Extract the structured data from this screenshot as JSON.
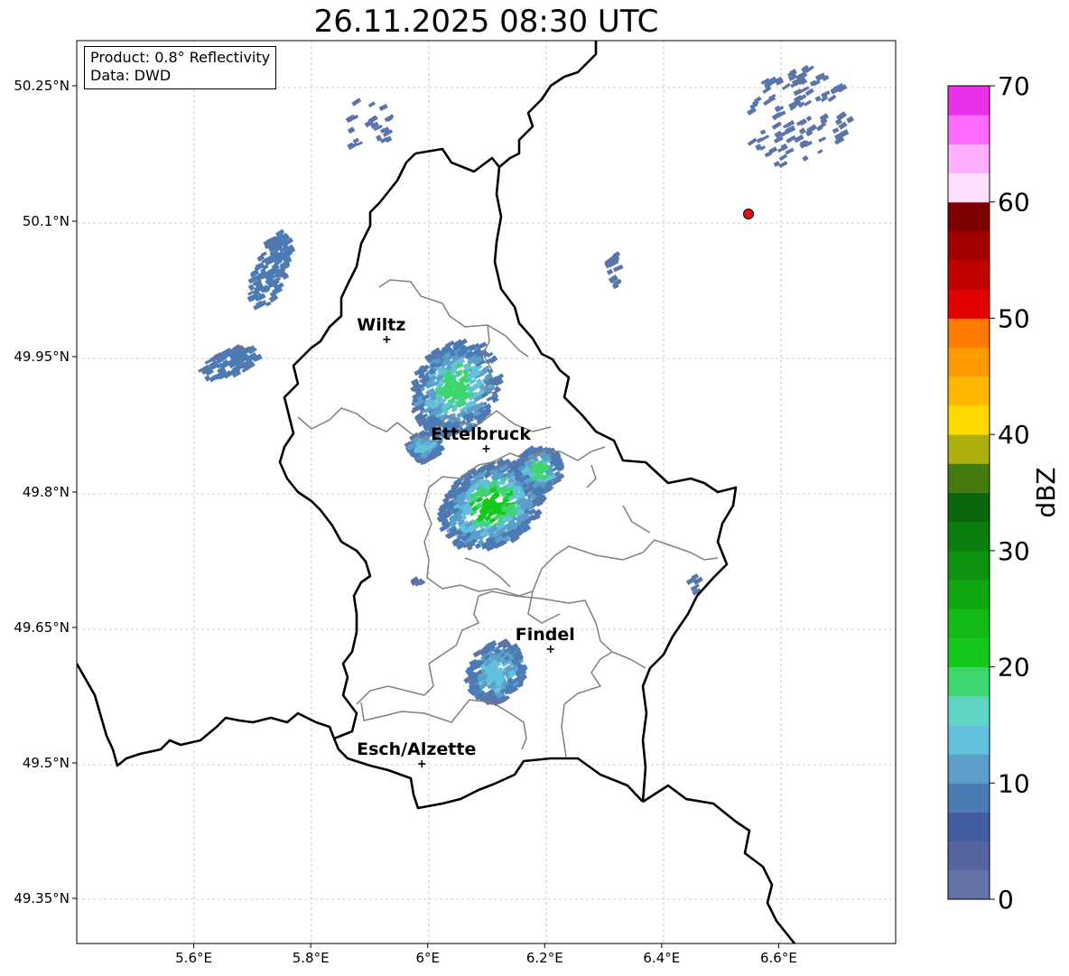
{
  "title": "26.11.2025 08:30 UTC",
  "info_box": {
    "line1": "Product: 0.8° Reflectivity",
    "line2": "Data: DWD"
  },
  "axes": {
    "lon_ticks": [
      "5.6°E",
      "5.8°E",
      "6°E",
      "6.2°E",
      "6.4°E",
      "6.6°E"
    ],
    "lat_ticks": [
      "50.25°N",
      "50.1°N",
      "49.95°N",
      "49.8°N",
      "49.65°N",
      "49.5°N",
      "49.35°N"
    ],
    "lon_range": [
      5.4,
      6.8
    ],
    "lat_range": [
      49.3,
      50.3
    ]
  },
  "places": [
    {
      "name": "Wiltz",
      "lon": 5.93,
      "lat": 49.969
    },
    {
      "name": "Ettelbruck",
      "lon": 6.1,
      "lat": 49.848
    },
    {
      "name": "Findel",
      "lon": 6.21,
      "lat": 49.626
    },
    {
      "name": "Esch/Alzette",
      "lon": 5.99,
      "lat": 49.499
    }
  ],
  "radar_site": {
    "lon": 6.547,
    "lat": 50.109,
    "color": "#e8100e"
  },
  "colorbar": {
    "label": "dBZ",
    "tick_labels": [
      "0",
      "10",
      "20",
      "30",
      "40",
      "50",
      "60",
      "70"
    ],
    "range": [
      0,
      70
    ],
    "colors": [
      "#6673a6",
      "#56659f",
      "#425da0",
      "#4a7bb4",
      "#5a9ec9",
      "#64c1dc",
      "#5fd6c3",
      "#3ed66e",
      "#14c91c",
      "#12bb18",
      "#10a812",
      "#0e9310",
      "#0c7e0e",
      "#0a650c",
      "#457a0e",
      "#adb00c",
      "#ffd800",
      "#ffb700",
      "#ff9b00",
      "#ff7b00",
      "#e30000",
      "#c10000",
      "#a30000",
      "#7c0000",
      "#ffdfff",
      "#ffafff",
      "#ff6bff",
      "#ea31ea"
    ]
  },
  "echo_colors": [
    "#5b75a8",
    "#4a7bb4",
    "#5a9ec9",
    "#64c1dc",
    "#3ed66e",
    "#14c91c"
  ]
}
